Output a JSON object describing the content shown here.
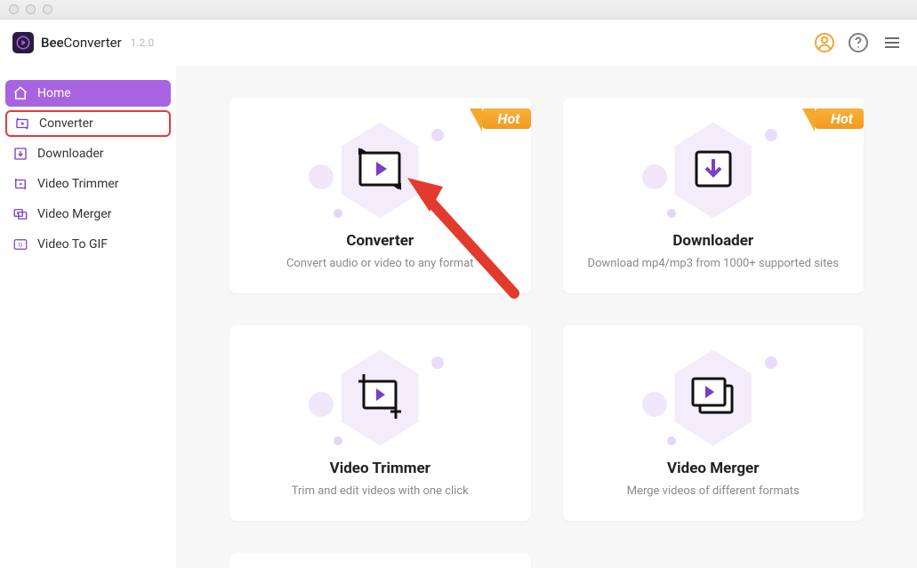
{
  "app": {
    "name_a": "Bee",
    "name_b": "Converter",
    "version": "1.2.0"
  },
  "sidebar": {
    "items": [
      {
        "label": "Home"
      },
      {
        "label": "Converter"
      },
      {
        "label": "Downloader"
      },
      {
        "label": "Video Trimmer"
      },
      {
        "label": "Video Merger"
      },
      {
        "label": "Video To GIF"
      }
    ]
  },
  "badges": {
    "hot": "Hot"
  },
  "cards": {
    "converter": {
      "title": "Converter",
      "desc": "Convert audio or video to any format"
    },
    "downloader": {
      "title": "Downloader",
      "desc": "Download mp4/mp3 from 1000+ supported sites"
    },
    "trimmer": {
      "title": "Video Trimmer",
      "desc": "Trim and edit videos with one click"
    },
    "merger": {
      "title": "Video Merger",
      "desc": "Merge videos of different formats"
    }
  }
}
